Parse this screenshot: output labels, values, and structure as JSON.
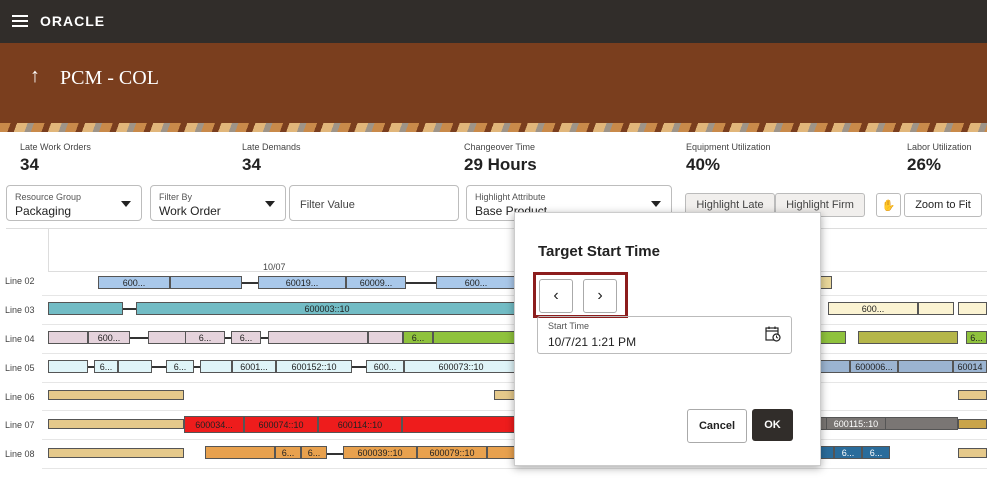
{
  "app": {
    "logo": "ORACLE",
    "title": "PCM - COL"
  },
  "metrics": [
    {
      "label": "Late Work Orders",
      "value": "34"
    },
    {
      "label": "Late Demands",
      "value": "34"
    },
    {
      "label": "Changeover Time",
      "value": "29 Hours"
    },
    {
      "label": "Equipment Utilization",
      "value": "40%"
    },
    {
      "label": "Labor Utilization",
      "value": "26%"
    }
  ],
  "filters": {
    "resource_group": {
      "label": "Resource Group",
      "value": "Packaging"
    },
    "filter_by": {
      "label": "Filter By",
      "value": "Work Order"
    },
    "filter_value": {
      "placeholder": "Filter Value"
    },
    "highlight_attribute": {
      "label": "Highlight Attribute",
      "value": "Base Product"
    }
  },
  "toolbar": {
    "highlight_late": "Highlight Late",
    "highlight_firm": "Highlight Firm",
    "zoom_to_fit": "Zoom to Fit"
  },
  "gantt": {
    "date": "10/07",
    "rows": [
      "Line 02",
      "Line 03",
      "Line 04",
      "Line 05",
      "Line 06",
      "Line 07",
      "Line 08"
    ],
    "bar_labels": {
      "l2a": "600...",
      "l2b": "60019...",
      "l2c": "60009...",
      "l2d": "600...",
      "l3a": "600003::10",
      "l3b": "600...",
      "l4a": "600...",
      "l4b": "6...",
      "l4c": "6...",
      "l4d": "6...",
      "l4e": "6...",
      "l5a": "6...",
      "l5b": "6...",
      "l5c": "6001...",
      "l5d": "600152::10",
      "l5e": "600...",
      "l5f": "600073::10",
      "l5g": "600006...",
      "l5h": "60014",
      "l7a": "600034...",
      "l7b": "600074::10",
      "l7c": "600114::10",
      "l7d": "600115::10",
      "l8a": "6...",
      "l8b": "6...",
      "l8c": "600039::10",
      "l8d": "600079::10",
      "l8e": "6...",
      "l8f": "6..."
    }
  },
  "dialog": {
    "title": "Target Start Time",
    "prev_icon": "‹",
    "next_icon": "›",
    "start_label": "Start Time",
    "start_value": "10/7/21 1:21 PM",
    "cancel": "Cancel",
    "ok": "OK"
  }
}
